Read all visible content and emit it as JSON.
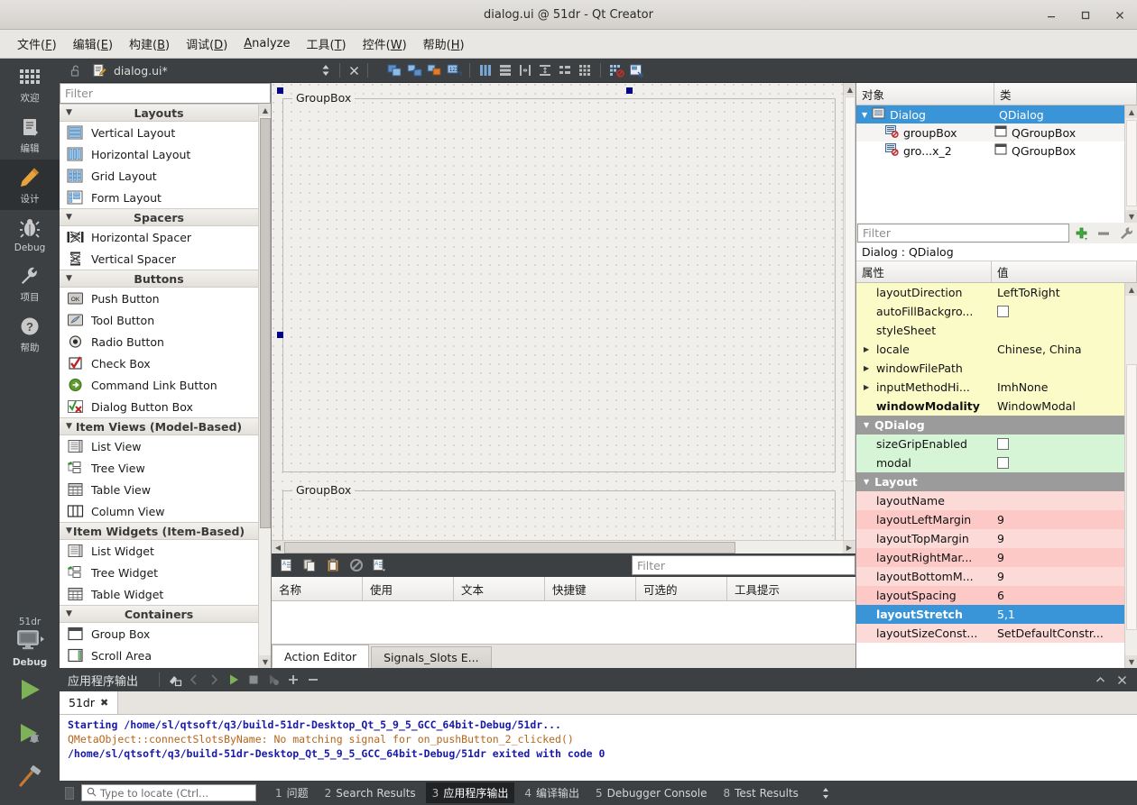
{
  "window": {
    "title": "dialog.ui @ 51dr - Qt Creator",
    "minimize": "minimize-icon",
    "maximize": "maximize-icon",
    "close": "close-icon"
  },
  "menubar": {
    "items": [
      {
        "text": "文件(F)",
        "pre": "文件(",
        "mn": "F",
        "post": ")"
      },
      {
        "text": "编辑(E)",
        "pre": "编辑(",
        "mn": "E",
        "post": ")"
      },
      {
        "text": "构建(B)",
        "pre": "构建(",
        "mn": "B",
        "post": ")"
      },
      {
        "text": "调试(D)",
        "pre": "调试(",
        "mn": "D",
        "post": ")"
      },
      {
        "text": "Analyze",
        "pre": "",
        "mn": "A",
        "post": "nalyze"
      },
      {
        "text": "工具(T)",
        "pre": "工具(",
        "mn": "T",
        "post": ")"
      },
      {
        "text": "控件(W)",
        "pre": "控件(",
        "mn": "W",
        "post": ")"
      },
      {
        "text": "帮助(H)",
        "pre": "帮助(",
        "mn": "H",
        "post": ")"
      }
    ]
  },
  "modebar": {
    "modes": [
      {
        "label": "欢迎",
        "icon": "grid-icon",
        "active": false
      },
      {
        "label": "编辑",
        "icon": "document-icon",
        "active": false
      },
      {
        "label": "设计",
        "icon": "pencil-icon",
        "active": true
      },
      {
        "label": "Debug",
        "icon": "bug-icon",
        "active": false
      },
      {
        "label": "项目",
        "icon": "wrench-icon",
        "active": false
      },
      {
        "label": "帮助",
        "icon": "question-icon",
        "active": false
      }
    ],
    "kit": {
      "name": "51dr",
      "label": "Debug",
      "icon": "monitor-icon"
    },
    "run": "run-icon",
    "debug": "run-debug-icon",
    "build": "hammer-icon"
  },
  "editor_toolbar": {
    "lock_icon": "lock-open-icon",
    "file_icon": "ui-file-icon",
    "filename": "dialog.ui*",
    "split_icon": "split-updown-icon",
    "close_icon": "close-document-icon",
    "tools": [
      "edit-widgets-icon",
      "edit-signals-slots-icon",
      "edit-buddies-icon",
      "edit-tab-order-icon",
      "layout-horizontal-icon",
      "layout-vertical-icon",
      "layout-splitter-h-icon",
      "layout-splitter-v-icon",
      "layout-form-icon",
      "layout-grid-icon",
      "break-layout-icon",
      "adjust-size-icon"
    ]
  },
  "widgetbox": {
    "filter_placeholder": "Filter",
    "sections": [
      {
        "title": "Layouts",
        "items": [
          {
            "label": "Vertical Layout",
            "icon": "vertical-layout-icon"
          },
          {
            "label": "Horizontal Layout",
            "icon": "horizontal-layout-icon"
          },
          {
            "label": "Grid Layout",
            "icon": "grid-layout-icon"
          },
          {
            "label": "Form Layout",
            "icon": "form-layout-icon"
          }
        ]
      },
      {
        "title": "Spacers",
        "items": [
          {
            "label": "Horizontal Spacer",
            "icon": "horizontal-spacer-icon"
          },
          {
            "label": "Vertical Spacer",
            "icon": "vertical-spacer-icon"
          }
        ]
      },
      {
        "title": "Buttons",
        "items": [
          {
            "label": "Push Button",
            "icon": "push-button-icon"
          },
          {
            "label": "Tool Button",
            "icon": "tool-button-icon"
          },
          {
            "label": "Radio Button",
            "icon": "radio-button-icon"
          },
          {
            "label": "Check Box",
            "icon": "check-box-icon"
          },
          {
            "label": "Command Link Button",
            "icon": "command-link-button-icon"
          },
          {
            "label": "Dialog Button Box",
            "icon": "dialog-button-box-icon"
          }
        ]
      },
      {
        "title": "Item Views (Model-Based)",
        "items": [
          {
            "label": "List View",
            "icon": "list-view-icon"
          },
          {
            "label": "Tree View",
            "icon": "tree-view-icon"
          },
          {
            "label": "Table View",
            "icon": "table-view-icon"
          },
          {
            "label": "Column View",
            "icon": "column-view-icon"
          }
        ]
      },
      {
        "title": "Item Widgets (Item-Based)",
        "items": [
          {
            "label": "List Widget",
            "icon": "list-widget-icon"
          },
          {
            "label": "Tree Widget",
            "icon": "tree-widget-icon"
          },
          {
            "label": "Table Widget",
            "icon": "table-widget-icon"
          }
        ]
      },
      {
        "title": "Containers",
        "items": [
          {
            "label": "Group Box",
            "icon": "group-box-icon"
          },
          {
            "label": "Scroll Area",
            "icon": "scroll-area-icon"
          }
        ]
      }
    ]
  },
  "canvas": {
    "groupbox1_title": "GroupBox",
    "groupbox2_title": "GroupBox"
  },
  "action_editor": {
    "toolbar_icons": [
      "new-action-icon",
      "copy-icon",
      "paste-icon",
      "delete-icon",
      "edit-action-icon"
    ],
    "filter_placeholder": "Filter",
    "columns": [
      "名称",
      "使用",
      "文本",
      "快捷键",
      "可选的",
      "工具提示"
    ],
    "rows": [],
    "tabs": [
      {
        "label": "Action Editor",
        "active": true
      },
      {
        "label": "Signals_Slots E...",
        "active": false
      }
    ]
  },
  "object_inspector": {
    "columns": [
      "对象",
      "类"
    ],
    "rows": [
      {
        "name": "Dialog",
        "class": "QDialog",
        "icon": "dialog-icon",
        "selected": true,
        "indent": 0,
        "expander": true
      },
      {
        "name": "groupBox",
        "class": "QGroupBox",
        "icon": "groupbox-nolayout-icon",
        "selected": false,
        "indent": 1,
        "expander": false
      },
      {
        "name": "gro...x_2",
        "class": "QGroupBox",
        "icon": "groupbox-nolayout-icon",
        "selected": false,
        "indent": 1,
        "expander": false
      }
    ]
  },
  "property_filter": {
    "placeholder": "Filter",
    "add_icon": "add-plus-icon",
    "remove_icon": "remove-minus-icon",
    "config_icon": "configure-wrench-icon"
  },
  "property_editor": {
    "object_line": "Dialog : QDialog",
    "columns": [
      "属性",
      "值"
    ],
    "rows": [
      {
        "kind": "prop",
        "name": "layoutDirection",
        "value": "LeftToRight",
        "tint": "yellow",
        "arrow": false,
        "bold": false,
        "checkbox": false
      },
      {
        "kind": "prop",
        "name": "autoFillBackgro...",
        "value": "",
        "tint": "yellow",
        "arrow": false,
        "bold": false,
        "checkbox": true
      },
      {
        "kind": "prop",
        "name": "styleSheet",
        "value": "",
        "tint": "yellow",
        "arrow": false,
        "bold": false,
        "checkbox": false
      },
      {
        "kind": "prop",
        "name": "locale",
        "value": "Chinese, China",
        "tint": "yellow",
        "arrow": true,
        "bold": false,
        "checkbox": false
      },
      {
        "kind": "prop",
        "name": "windowFilePath",
        "value": "",
        "tint": "yellow",
        "arrow": true,
        "bold": false,
        "checkbox": false
      },
      {
        "kind": "prop",
        "name": "inputMethodHi...",
        "value": "ImhNone",
        "tint": "yellow",
        "arrow": true,
        "bold": false,
        "checkbox": false
      },
      {
        "kind": "prop",
        "name": "windowModality",
        "value": "WindowModal",
        "tint": "yellow",
        "arrow": false,
        "bold": true,
        "checkbox": false
      },
      {
        "kind": "group",
        "name": "QDialog"
      },
      {
        "kind": "prop",
        "name": "sizeGripEnabled",
        "value": "",
        "tint": "green",
        "arrow": false,
        "bold": false,
        "checkbox": true
      },
      {
        "kind": "prop",
        "name": "modal",
        "value": "",
        "tint": "green",
        "arrow": false,
        "bold": false,
        "checkbox": true
      },
      {
        "kind": "group",
        "name": "Layout"
      },
      {
        "kind": "prop",
        "name": "layoutName",
        "value": "",
        "tint": "pink",
        "arrow": false,
        "bold": false,
        "checkbox": false
      },
      {
        "kind": "prop",
        "name": "layoutLeftMargin",
        "value": "9",
        "tint": "pink",
        "arrow": false,
        "bold": false,
        "checkbox": false
      },
      {
        "kind": "prop",
        "name": "layoutTopMargin",
        "value": "9",
        "tint": "pink",
        "arrow": false,
        "bold": false,
        "checkbox": false
      },
      {
        "kind": "prop",
        "name": "layoutRightMar...",
        "value": "9",
        "tint": "pink",
        "arrow": false,
        "bold": false,
        "checkbox": false
      },
      {
        "kind": "prop",
        "name": "layoutBottomM...",
        "value": "9",
        "tint": "pink",
        "arrow": false,
        "bold": false,
        "checkbox": false
      },
      {
        "kind": "prop",
        "name": "layoutSpacing",
        "value": "6",
        "tint": "pink",
        "arrow": false,
        "bold": false,
        "checkbox": false
      },
      {
        "kind": "prop",
        "name": "layoutStretch",
        "value": "5,1",
        "tint": "selected",
        "arrow": false,
        "bold": true,
        "checkbox": false
      },
      {
        "kind": "prop",
        "name": "layoutSizeConst...",
        "value": "SetDefaultConstr...",
        "tint": "pink",
        "arrow": false,
        "bold": false,
        "checkbox": false
      }
    ]
  },
  "output_pane": {
    "title": "应用程序输出",
    "icons": [
      "clean-output-icon",
      "prev-item-icon",
      "next-item-icon",
      "run-output-icon",
      "stop-output-icon",
      "attach-debugger-icon",
      "zoom-in-icon",
      "zoom-out-icon"
    ],
    "right_icons": [
      "maximize-pane-icon",
      "close-pane-icon"
    ],
    "tab": {
      "label": "51dr",
      "close": "close-tab-icon"
    },
    "lines": [
      {
        "text": "Starting /home/sl/qtsoft/q3/build-51dr-Desktop_Qt_5_9_5_GCC_64bit-Debug/51dr...",
        "color": "#1a1aa8"
      },
      {
        "text": "QMetaObject::connectSlotsByName: No matching signal for on_pushButton_2_clicked()",
        "color": "#b5651d"
      },
      {
        "text": "/home/sl/qtsoft/q3/build-51dr-Desktop_Qt_5_9_5_GCC_64bit-Debug/51dr exited with code 0",
        "color": "#1a1aa8"
      }
    ]
  },
  "statusbar": {
    "locate_placeholder": "Type to locate (Ctrl...",
    "search_icon": "search-icon",
    "items": [
      {
        "num": "1",
        "label": "问题",
        "active": false
      },
      {
        "num": "2",
        "label": "Search Results",
        "active": false
      },
      {
        "num": "3",
        "label": "应用程序输出",
        "active": true
      },
      {
        "num": "4",
        "label": "编译输出",
        "active": false
      },
      {
        "num": "5",
        "label": "Debugger Console",
        "active": false
      },
      {
        "num": "8",
        "label": "Test Results",
        "active": false
      }
    ],
    "more_icon": "updown-arrows-icon"
  },
  "colors": {
    "accent_blue": "#3a95d8",
    "mode_bg": "#3c4042",
    "prop_yellow": "#fbfbc8",
    "prop_green": "#d6f5d6",
    "prop_pink": "#fcc9c7",
    "prop_pink_alt": "#fbdad8",
    "selection_navy": "#00008b"
  }
}
